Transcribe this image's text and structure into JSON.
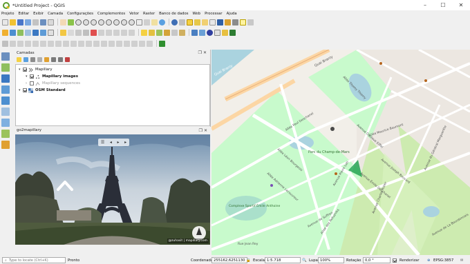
{
  "window": {
    "title": "*Untitled Project - QGIS"
  },
  "menu": [
    "Projeto",
    "Editar",
    "Exibir",
    "Camada",
    "Configurações",
    "Complementos",
    "Vetor",
    "Raster",
    "Banco de dados",
    "Web",
    "Processar",
    "Ajuda"
  ],
  "layers_panel": {
    "title": "Camadas",
    "groups": [
      {
        "label": "Mapillary",
        "checked": true,
        "children": [
          {
            "label": "Mapillary images",
            "checked": true
          },
          {
            "label": "Mapillary sequences",
            "checked": false
          }
        ]
      },
      {
        "label": "OSM Standard",
        "checked": true
      }
    ]
  },
  "g2m_panel": {
    "title": "go2mapillary",
    "attribution": "@zuhasit | mapillary.com"
  },
  "map": {
    "labels": [
      "Quai Branly",
      "Quai Branly",
      "Allée Thomy Thierry",
      "Avenue Gustave Eiffel",
      "Allée Paul Deschanel",
      "Allée Léon Bourgeois",
      "Allée Adrienne Lecouvreur",
      "Avenue Pierre Loti",
      "Avenue Charles Risler",
      "Avenue Émile Deschanel",
      "Avenue Joseph Bouvard",
      "Avenue du Général Margueritte",
      "Allée Maurice Baumont",
      "Avenue de Suffren",
      "Rue Jean Rey",
      "Allée des Refuzniks",
      "Avenue de La Bourdonnais",
      "Parc du Champ-de-Mars",
      "Complexe Sportif Émile Anthoine"
    ]
  },
  "status": {
    "locator_placeholder": "Type to locate (Ctrl+K)",
    "ready": "Pronto",
    "coord_label": "Coordenada",
    "coord_value": "255162,6251130",
    "scale_label": "Escala",
    "scale_value": "1:5.718",
    "magnifier_label": "Lupa",
    "magnifier_value": "100%",
    "rotation_label": "Rotação",
    "rotation_value": "0,0 °",
    "render_label": "Renderizar",
    "crs": "EPSG:3857"
  },
  "colors": {
    "accent": "#2f8f2f",
    "park": "#c8facc",
    "road": "#ffffff",
    "major_road": "#fcd6a4",
    "water": "#aad3df"
  }
}
